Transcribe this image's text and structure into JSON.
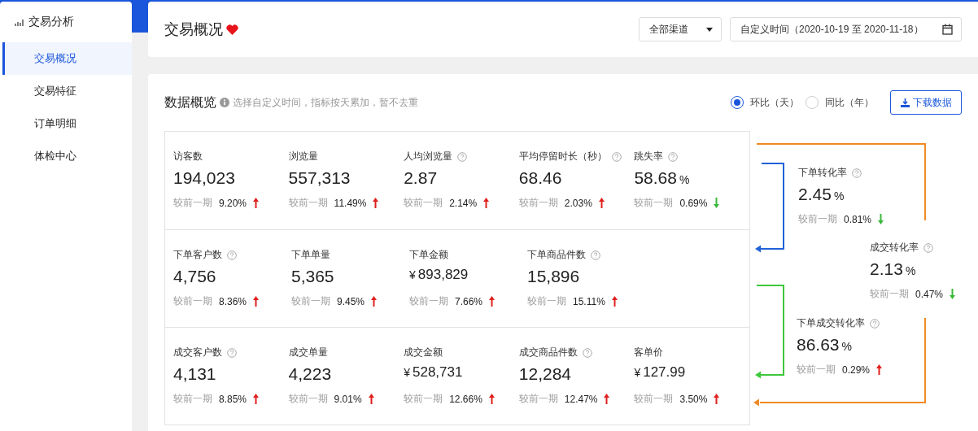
{
  "sidebar": {
    "title": "交易分析",
    "items": [
      {
        "label": "交易概况",
        "selected": true
      },
      {
        "label": "交易特征",
        "selected": false
      },
      {
        "label": "订单明细",
        "selected": false
      },
      {
        "label": "体检中心",
        "selected": false
      }
    ]
  },
  "header": {
    "title": "交易概况",
    "channel": "全部渠道",
    "date_range": "自定义时间（2020-10-19 至 2020-11-18）"
  },
  "overview": {
    "title": "数据概览",
    "hint": "选择自定义时间，指标按天累加，暂不去重",
    "compare": [
      {
        "label": "环比（天）",
        "selected": true
      },
      {
        "label": "同比（年）",
        "selected": false
      }
    ],
    "download": "下载数据",
    "rows": [
      [
        {
          "label": "访客数",
          "help": false,
          "value": "194,023",
          "compare_label": "较前一期",
          "change": "9.20%",
          "kind": "up"
        },
        {
          "label": "浏览量",
          "help": false,
          "value": "557,313",
          "compare_label": "较前一期",
          "change": "11.49%",
          "kind": "up"
        },
        {
          "label": "人均浏览量",
          "help": true,
          "value": "2.87",
          "compare_label": "较前一期",
          "change": "2.14%",
          "kind": "up"
        },
        {
          "label": "平均停留时长（秒）",
          "help": true,
          "value": "68.46",
          "compare_label": "较前一期",
          "change": "2.03%",
          "kind": "up"
        },
        {
          "label": "跳失率",
          "help": true,
          "value": "58.68",
          "suffix": "%",
          "compare_label": "较前一期",
          "change": "0.69%",
          "kind": "down"
        }
      ],
      [
        {
          "label": "下单客户数",
          "help": true,
          "value": "4,756",
          "compare_label": "较前一期",
          "change": "8.36%",
          "kind": "up"
        },
        {
          "label": "下单单量",
          "help": false,
          "value": "5,365",
          "compare_label": "较前一期",
          "change": "9.45%",
          "kind": "up"
        },
        {
          "label": "下单金额",
          "help": false,
          "prefix": "¥",
          "value": "893,829",
          "compare_label": "较前一期",
          "change": "7.66%",
          "kind": "up"
        },
        {
          "label": "下单商品件数",
          "help": true,
          "value": "15,896",
          "compare_label": "较前一期",
          "change": "15.11%",
          "kind": "up"
        }
      ],
      [
        {
          "label": "成交客户数",
          "help": true,
          "value": "4,131",
          "compare_label": "较前一期",
          "change": "8.85%",
          "kind": "up"
        },
        {
          "label": "成交单量",
          "help": false,
          "value": "4,223",
          "compare_label": "较前一期",
          "change": "9.01%",
          "kind": "up"
        },
        {
          "label": "成交金额",
          "help": false,
          "prefix": "¥",
          "value": "528,731",
          "compare_label": "较前一期",
          "change": "12.66%",
          "kind": "up"
        },
        {
          "label": "成交商品件数",
          "help": true,
          "value": "12,284",
          "compare_label": "较前一期",
          "change": "12.47%",
          "kind": "up"
        },
        {
          "label": "客单价",
          "help": false,
          "prefix": "¥",
          "value": "127.99",
          "compare_label": "较前一期",
          "change": "3.50%",
          "kind": "up"
        }
      ]
    ],
    "conversions": [
      {
        "label": "下单转化率",
        "help": true,
        "value": "2.45",
        "suffix": "%",
        "compare_label": "较前一期",
        "change": "0.81%",
        "kind": "down"
      },
      {
        "label": "成交转化率",
        "help": true,
        "value": "2.13",
        "suffix": "%",
        "compare_label": "较前一期",
        "change": "0.47%",
        "kind": "down"
      },
      {
        "label": "下单成交转化率",
        "help": true,
        "value": "86.63",
        "suffix": "%",
        "compare_label": "较前一期",
        "change": "0.29%",
        "kind": "up"
      }
    ]
  }
}
